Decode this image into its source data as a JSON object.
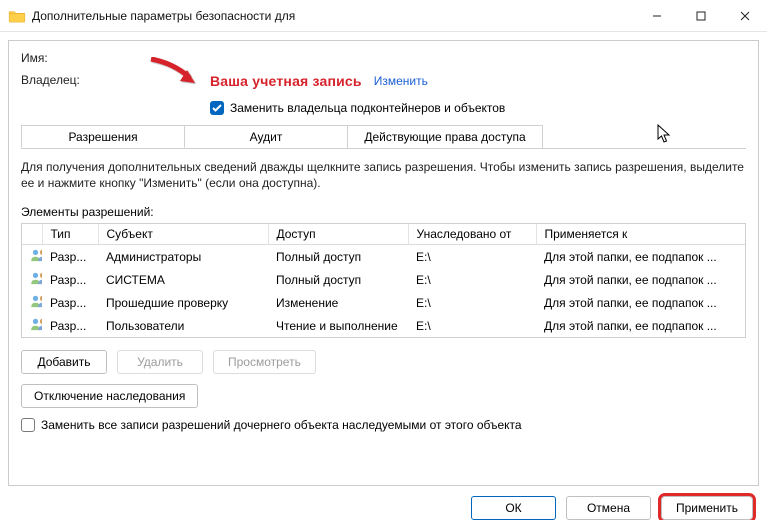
{
  "window": {
    "title": "Дополнительные параметры безопасности  для"
  },
  "labels": {
    "name": "Имя:",
    "owner": "Владелец:",
    "owner_value": "Ваша учетная запись",
    "change_link": "Изменить",
    "replace_owner_checkbox": "Заменить владельца подконтейнеров и объектов",
    "permission_entries": "Элементы разрешений:",
    "replace_all": "Заменить все записи разрешений дочернего объекта наследуемыми от этого объекта"
  },
  "tabs": [
    {
      "label": "Разрешения",
      "active": true
    },
    {
      "label": "Аудит",
      "active": false
    },
    {
      "label": "Действующие права доступа",
      "active": false
    }
  ],
  "help_text": "Для получения дополнительных сведений дважды щелкните запись разрешения. Чтобы изменить запись разрешения, выделите ее и нажмите кнопку \"Изменить\" (если она доступна).",
  "table": {
    "headers": [
      "Тип",
      "Субъект",
      "Доступ",
      "Унаследовано от",
      "Применяется к"
    ],
    "rows": [
      {
        "type": "Разр...",
        "subject": "Администраторы",
        "access": "Полный доступ",
        "inherited": "E:\\",
        "applies": "Для этой папки, ее подпапок ..."
      },
      {
        "type": "Разр...",
        "subject": "СИСТЕМА",
        "access": "Полный доступ",
        "inherited": "E:\\",
        "applies": "Для этой папки, ее подпапок ..."
      },
      {
        "type": "Разр...",
        "subject": "Прошедшие проверку",
        "access": "Изменение",
        "inherited": "E:\\",
        "applies": "Для этой папки, ее подпапок ..."
      },
      {
        "type": "Разр...",
        "subject": "Пользователи",
        "access": "Чтение и выполнение",
        "inherited": "E:\\",
        "applies": "Для этой папки, ее подпапок ..."
      }
    ]
  },
  "buttons": {
    "add": "Добавить",
    "remove": "Удалить",
    "view": "Просмотреть",
    "disable_inherit": "Отключение наследования",
    "ok": "ОК",
    "cancel": "Отмена",
    "apply": "Применить"
  }
}
